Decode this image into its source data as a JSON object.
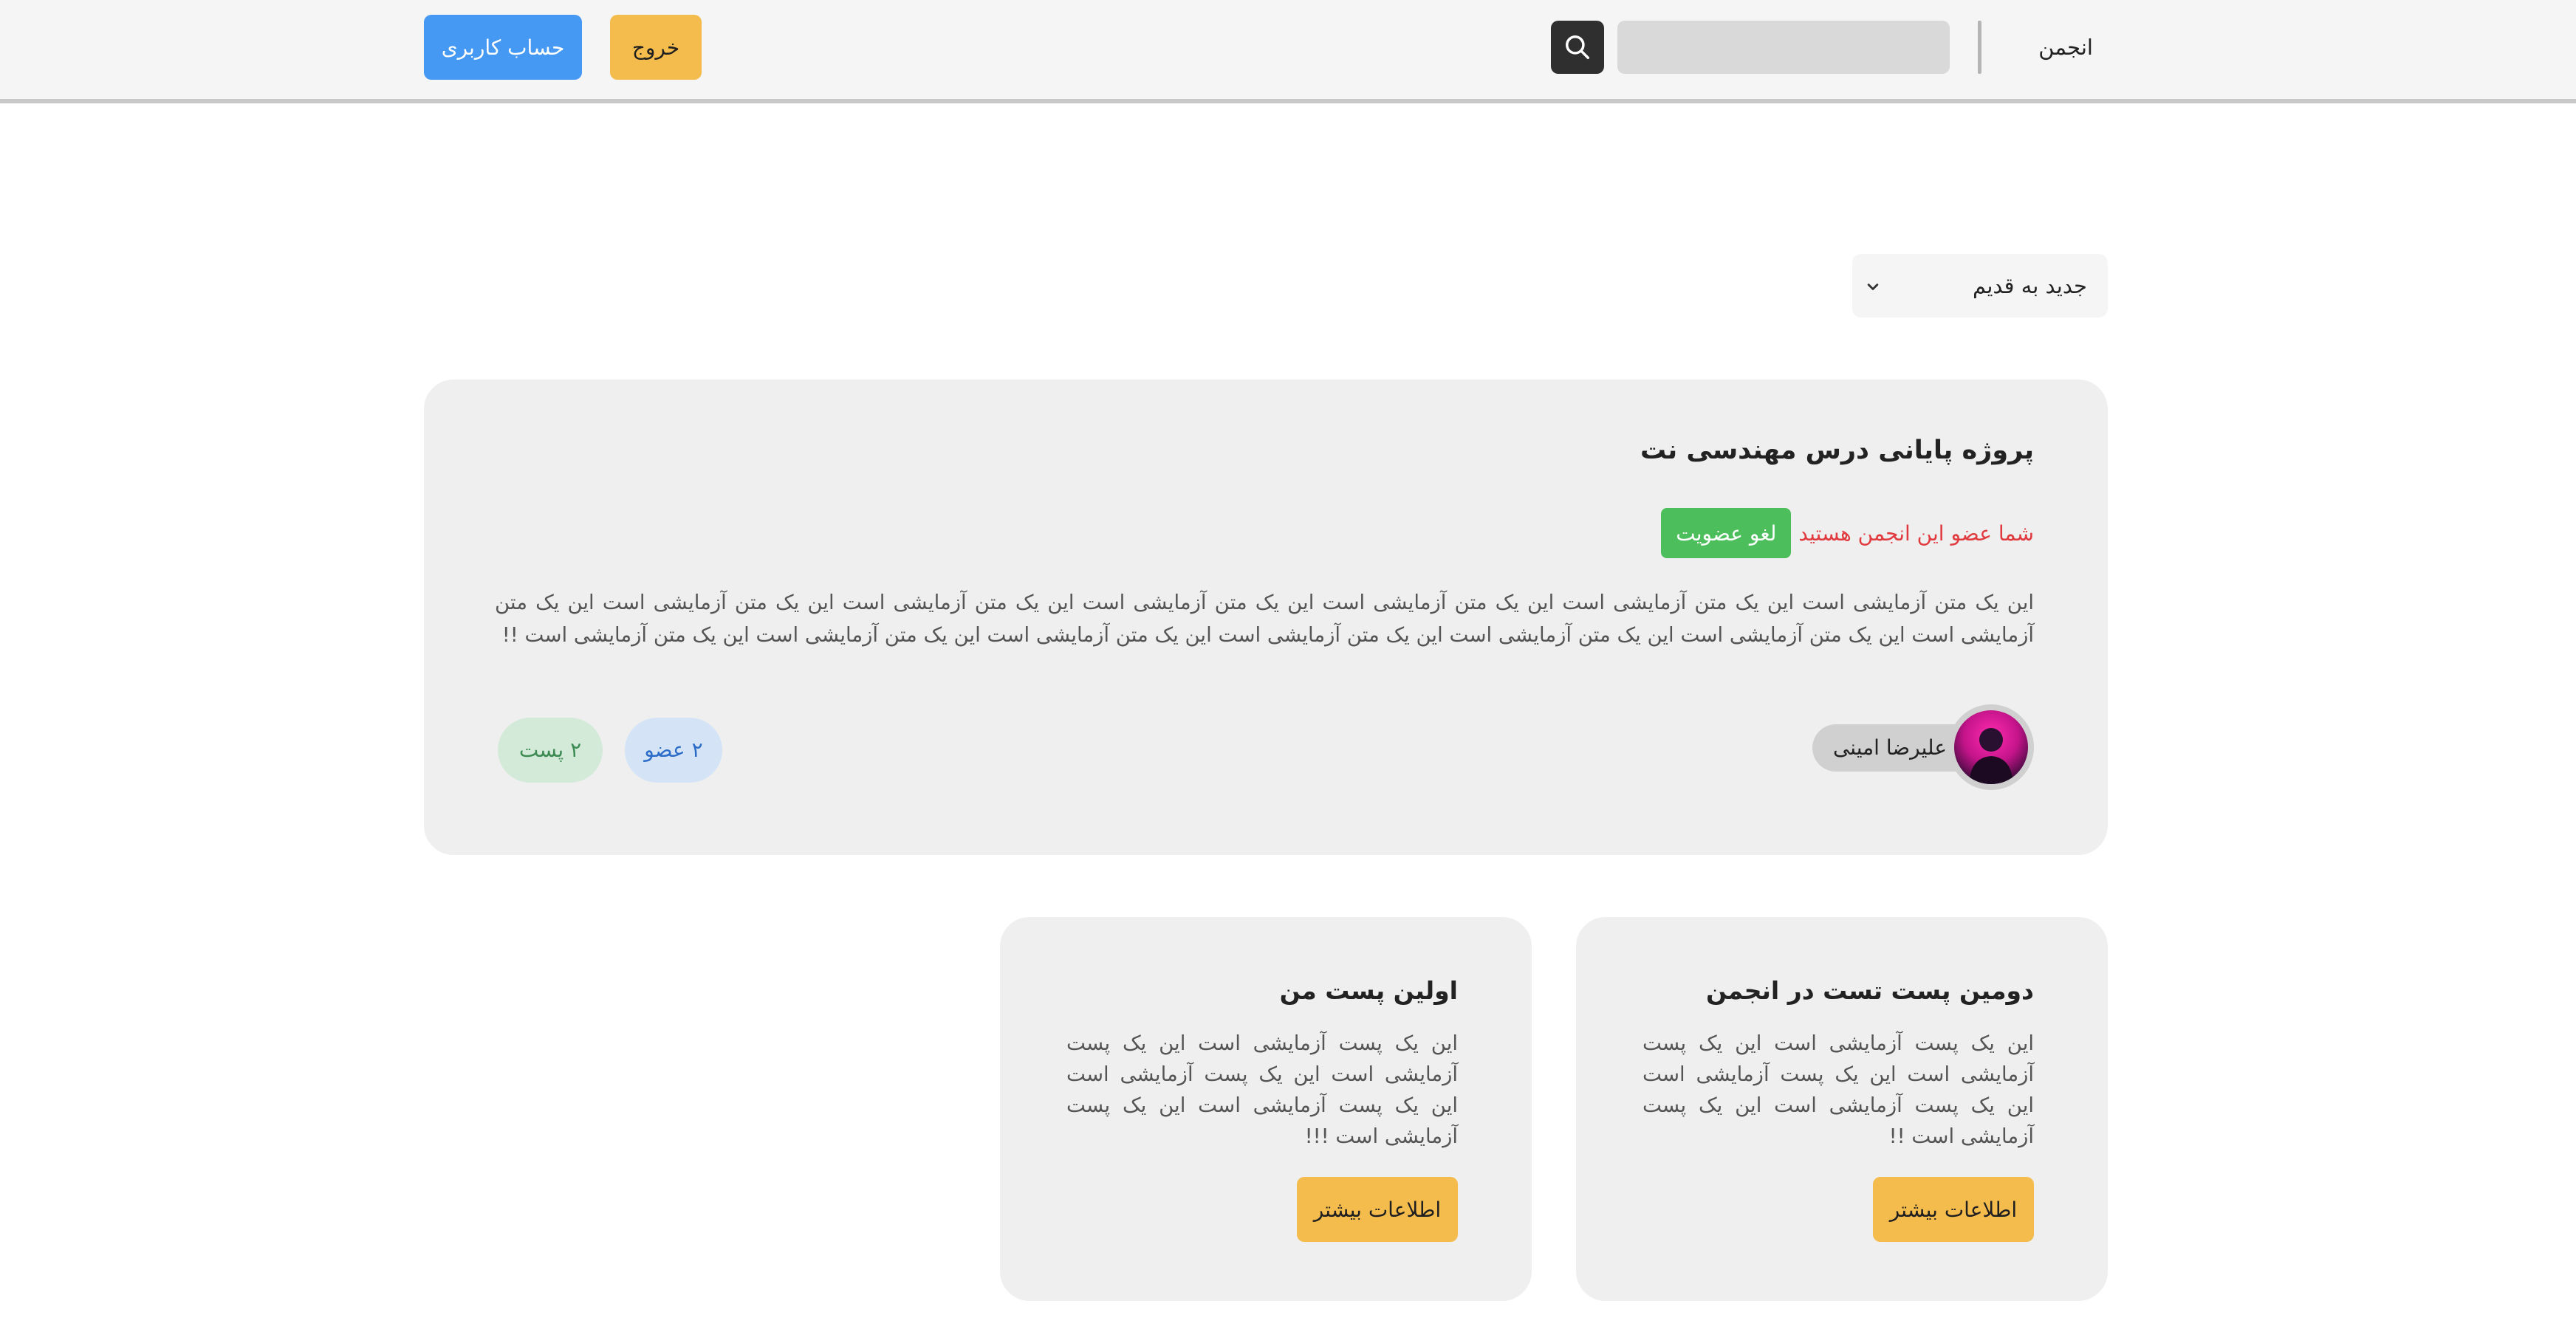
{
  "navbar": {
    "brand": "انجمن",
    "search": {
      "value": "",
      "placeholder": ""
    },
    "logout_label": "خروج",
    "account_label": "حساب کاربری"
  },
  "sort": {
    "selected": "جدید به قدیم"
  },
  "community": {
    "title": "پروژه پایانی درس مهندسی نت",
    "member_status": "شما عضو این انجمن هستید",
    "leave_label": "لغو عضویت",
    "description": "این یک متن آزمایشی است این یک متن آزمایشی است این یک متن آزمایشی است این یک متن آزمایشی است این یک متن آزمایشی است این یک متن آزمایشی است این یک متن آزمایشی است این یک متن آزمایشی است این یک متن آزمایشی است این یک متن آزمایشی است این یک متن آزمایشی است این یک متن آزمایشی است این یک متن آزمایشی است !!",
    "author": "علیرضا امینی",
    "members_label": "۲ عضو",
    "posts_label": "۲ پست"
  },
  "posts": [
    {
      "title": "دومین پست تست در انجمن",
      "body": "این یک پست آزمایشی است این یک پست آزمایشی است این یک پست آزمایشی است این یک پست آزمایشی است این یک پست آزمایشی است !!",
      "more_label": "اطلاعات بیشتر"
    },
    {
      "title": "اولین پست من",
      "body": "این یک پست آزمایشی است این یک پست آزمایشی است این یک پست آزمایشی است این یک پست آزمایشی است این یک پست آزمایشی است !!!",
      "more_label": "اطلاعات بیشتر"
    }
  ],
  "colors": {
    "accent_yellow": "#f4bb4d",
    "accent_blue": "#4599f2",
    "success_green": "#4cbe5b",
    "alert_red": "#e0393e"
  }
}
